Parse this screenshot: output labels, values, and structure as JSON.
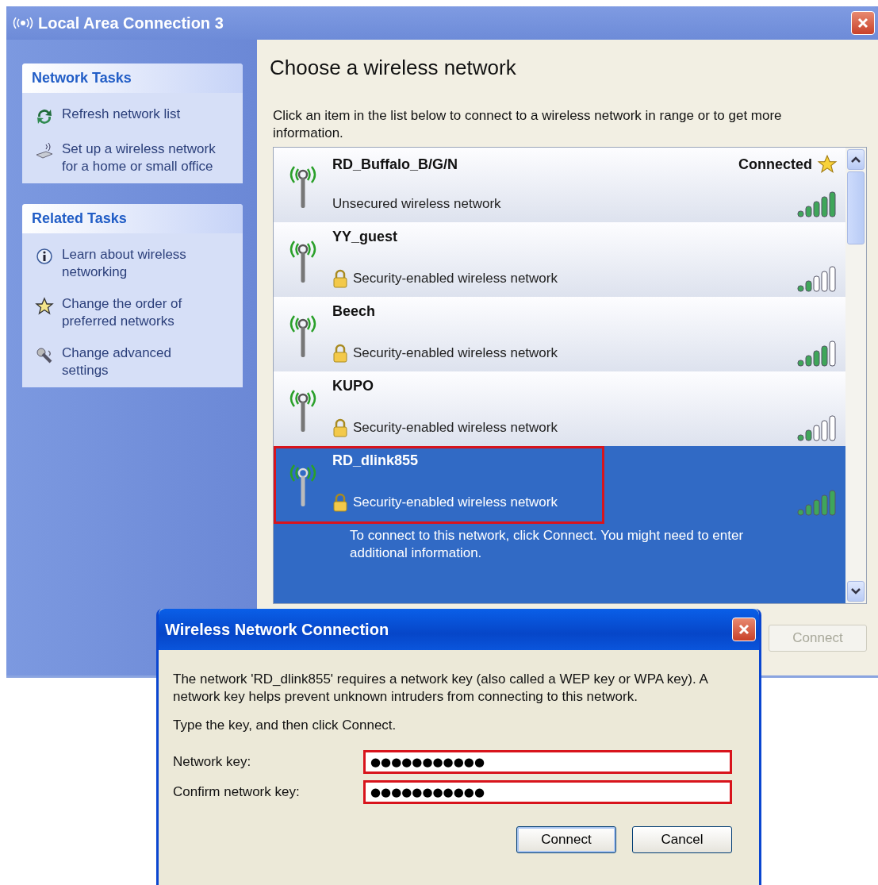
{
  "window": {
    "title": "Local Area Connection 3"
  },
  "sidebar": {
    "sections": [
      {
        "title": "Network Tasks",
        "items": [
          {
            "label": "Refresh network list",
            "kind": "refresh"
          },
          {
            "label": "Set up a wireless network for a home or small office",
            "kind": "setup"
          }
        ]
      },
      {
        "title": "Related Tasks",
        "items": [
          {
            "label": "Learn about wireless networking",
            "kind": "info"
          },
          {
            "label": "Change the order of preferred networks",
            "kind": "star"
          },
          {
            "label": "Change advanced settings",
            "kind": "tools"
          }
        ]
      }
    ]
  },
  "content": {
    "heading": "Choose a wireless network",
    "instructions": "Click an item in the list below to connect to a wireless network in range or to get more information.",
    "networks": [
      {
        "name": "RD_Buffalo_B/G/N",
        "security": "Unsecured wireless network",
        "secured": false,
        "status": "Connected",
        "preferred": true,
        "level": 1,
        "selected": false,
        "highlighted": false
      },
      {
        "name": "YY_guest",
        "security": "Security-enabled wireless network",
        "secured": true,
        "preferred": false,
        "level": 0.4,
        "selected": false,
        "highlighted": false
      },
      {
        "name": "Beech",
        "security": "Security-enabled wireless network",
        "secured": true,
        "preferred": false,
        "level": 0.8,
        "selected": false,
        "highlighted": false
      },
      {
        "name": "KUPO",
        "security": "Security-enabled wireless network",
        "secured": true,
        "preferred": false,
        "level": 0.4,
        "selected": false,
        "highlighted": false
      },
      {
        "name": "RD_dlink855",
        "security": "Security-enabled wireless network",
        "secured": true,
        "preferred": false,
        "level": 1,
        "selected": true,
        "highlighted": true,
        "details": "To connect to this network, click Connect. You might need to enter additional information."
      }
    ],
    "connect_button": {
      "label": "Connect",
      "disabled": true
    }
  },
  "dialog": {
    "title": "Wireless Network Connection",
    "message": "The network 'RD_dlink855' requires a network key (also called a WEP key or WPA key). A network key helps prevent unknown intruders from connecting to this network.",
    "instruction": "Type the key, and then click Connect.",
    "fields": [
      {
        "label": "Network key:",
        "value": "●●●●●●●●●●●"
      },
      {
        "label": "Confirm network key:",
        "value": "●●●●●●●●●●●"
      }
    ],
    "fields_highlighted": true,
    "buttons": [
      {
        "label": "Connect",
        "default": true
      },
      {
        "label": "Cancel",
        "default": false
      }
    ]
  }
}
